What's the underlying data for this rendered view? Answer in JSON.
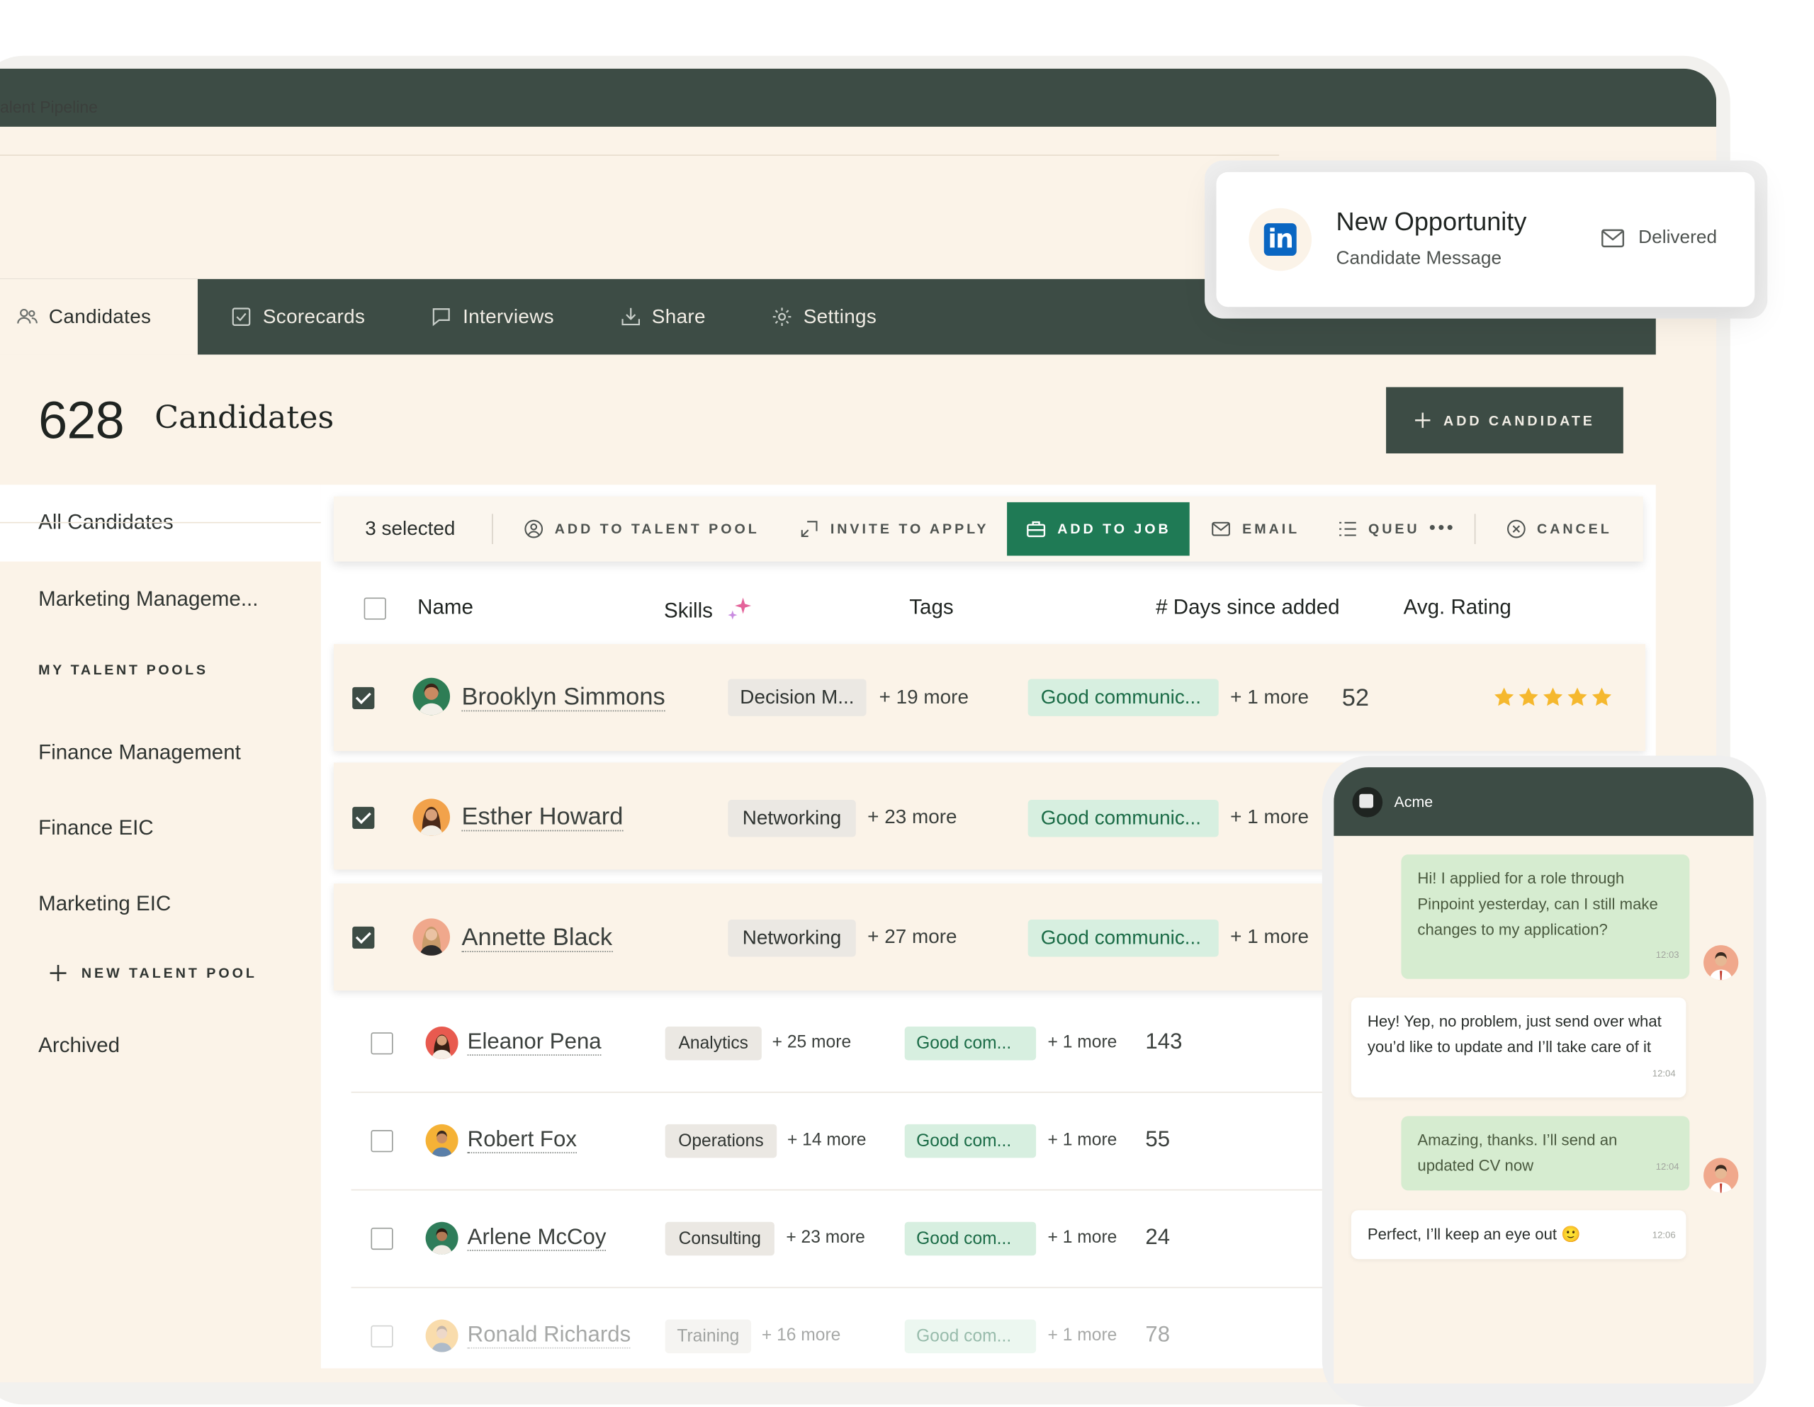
{
  "breadcrumb": "alent Pipeline",
  "tabs": [
    {
      "label": "Candidates",
      "icon": "users-icon"
    },
    {
      "label": "Scorecards",
      "icon": "checkbox-icon"
    },
    {
      "label": "Interviews",
      "icon": "chat-bubble-icon"
    },
    {
      "label": "Share",
      "icon": "download-icon"
    },
    {
      "label": "Settings",
      "icon": "gear-icon"
    }
  ],
  "header": {
    "count": "628",
    "label": "Candidates",
    "add_button": "ADD CANDIDATE"
  },
  "sidebar": {
    "all": "All Candidates",
    "marketing": "Marketing Manageme...",
    "pools_heading": "MY TALENT POOLS",
    "pools": [
      "Finance Management",
      "Finance EIC",
      "Marketing EIC"
    ],
    "new_pool": "NEW TALENT POOL",
    "archived": "Archived"
  },
  "actionbar": {
    "selected": "3 selected",
    "add_to_pool": "ADD TO TALENT POOL",
    "invite": "INVITE TO APPLY",
    "add_to_job": "ADD TO JOB",
    "email": "EMAIL",
    "queue": "QUEU",
    "more": "•••",
    "cancel": "CANCEL"
  },
  "columns": {
    "name": "Name",
    "skills": "Skills",
    "tags": "Tags",
    "days": "# Days since added",
    "rating": "Avg. Rating"
  },
  "rows": [
    {
      "name": "Brooklyn Simmons",
      "skill": "Decision M...",
      "skill_more": "+ 19 more",
      "tag": "Good communic...",
      "tag_more": "+ 1 more",
      "days": "52",
      "rating": 5,
      "selected": true
    },
    {
      "name": "Esther Howard",
      "skill": "Networking",
      "skill_more": "+ 23 more",
      "tag": "Good communic...",
      "tag_more": "+ 1 more",
      "selected": true
    },
    {
      "name": "Annette Black",
      "skill": "Networking",
      "skill_more": "+ 27 more",
      "tag": "Good communic...",
      "tag_more": "+ 1 more",
      "selected": true
    },
    {
      "name": "Eleanor Pena",
      "skill": "Analytics",
      "skill_more": "+ 25 more",
      "tag": "Good com...",
      "tag_more": "+ 1 more",
      "days": "143",
      "selected": false
    },
    {
      "name": "Robert Fox",
      "skill": "Operations",
      "skill_more": "+ 14 more",
      "tag": "Good com...",
      "tag_more": "+ 1 more",
      "days": "55",
      "selected": false
    },
    {
      "name": "Arlene McCoy",
      "skill": "Consulting",
      "skill_more": "+ 23 more",
      "tag": "Good com...",
      "tag_more": "+ 1 more",
      "days": "24",
      "selected": false
    },
    {
      "name": "Ronald Richards",
      "skill": "Training",
      "skill_more": "+ 16 more",
      "tag": "Good com...",
      "tag_more": "+ 1 more",
      "days": "78",
      "selected": false
    }
  ],
  "notification": {
    "icon": "linkedin-icon",
    "title": "New Opportunity",
    "subtitle": "Candidate Message",
    "status": "Delivered"
  },
  "chat": {
    "company": "Acme",
    "messages": [
      {
        "dir": "out",
        "text": "Hi! I applied for a role through Pinpoint yesterday, can I still make changes to my application?",
        "time": "12:03"
      },
      {
        "dir": "in",
        "text": "Hey! Yep, no problem, just send over what you’d like to update and I’ll take care of it",
        "time": "12:04"
      },
      {
        "dir": "out",
        "text": "Amazing, thanks. I’ll send an updated CV now",
        "time": "12:04"
      },
      {
        "dir": "in",
        "text": "Perfect, I’ll keep an eye out 🙂",
        "time": "12:06"
      }
    ]
  },
  "colors": {
    "brand_dark": "#3d4c45",
    "cream": "#fbf3e8",
    "primary_green": "#1f7a55",
    "tag_green_bg": "#d7efe0",
    "star": "#f5b82e",
    "linkedin": "#0a66c2"
  }
}
